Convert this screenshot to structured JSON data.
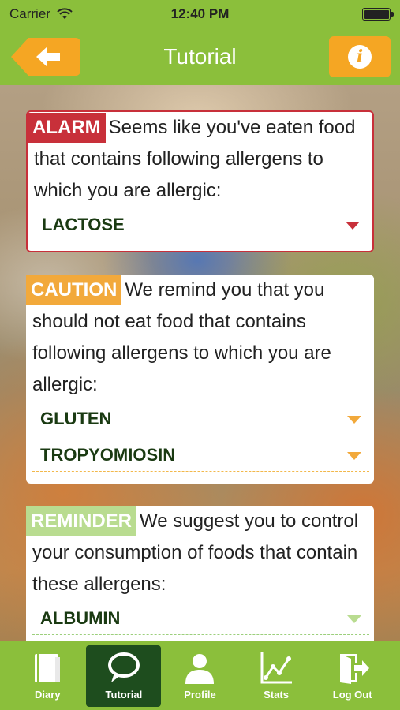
{
  "status_bar": {
    "carrier": "Carrier",
    "time": "12:40 PM"
  },
  "nav": {
    "title": "Tutorial",
    "back_icon": "back-arrow-icon",
    "info_icon": "info-icon",
    "info_glyph": "i"
  },
  "cards": {
    "alarm": {
      "tag": "ALARM",
      "text": "Seems like you've eaten food that contains following allergens to which you are allergic:",
      "allergens": [
        "LACTOSE"
      ],
      "color": "#c8303a"
    },
    "caution": {
      "tag": "CAUTION",
      "text": "We remind you that you should not eat food that contains following allergens to which you are allergic:",
      "allergens": [
        "GLUTEN",
        "TROPYOMIOSIN"
      ],
      "color": "#f2a93b"
    },
    "reminder": {
      "tag": "REMINDER",
      "text": "We suggest you to control your consumption of foods that contain these allergens:",
      "allergens": [
        "ALBUMIN"
      ],
      "color": "#b9dc90"
    }
  },
  "tabs": [
    {
      "label": "Diary",
      "icon": "book-icon",
      "active": false
    },
    {
      "label": "Tutorial",
      "icon": "speech-bubble-icon",
      "active": true
    },
    {
      "label": "Profile",
      "icon": "person-icon",
      "active": false
    },
    {
      "label": "Stats",
      "icon": "chart-icon",
      "active": false
    },
    {
      "label": "Log Out",
      "icon": "logout-icon",
      "active": false
    }
  ],
  "colors": {
    "brand_green": "#8bbf3b",
    "active_tab": "#1e4d1e",
    "orange": "#f5a623"
  }
}
